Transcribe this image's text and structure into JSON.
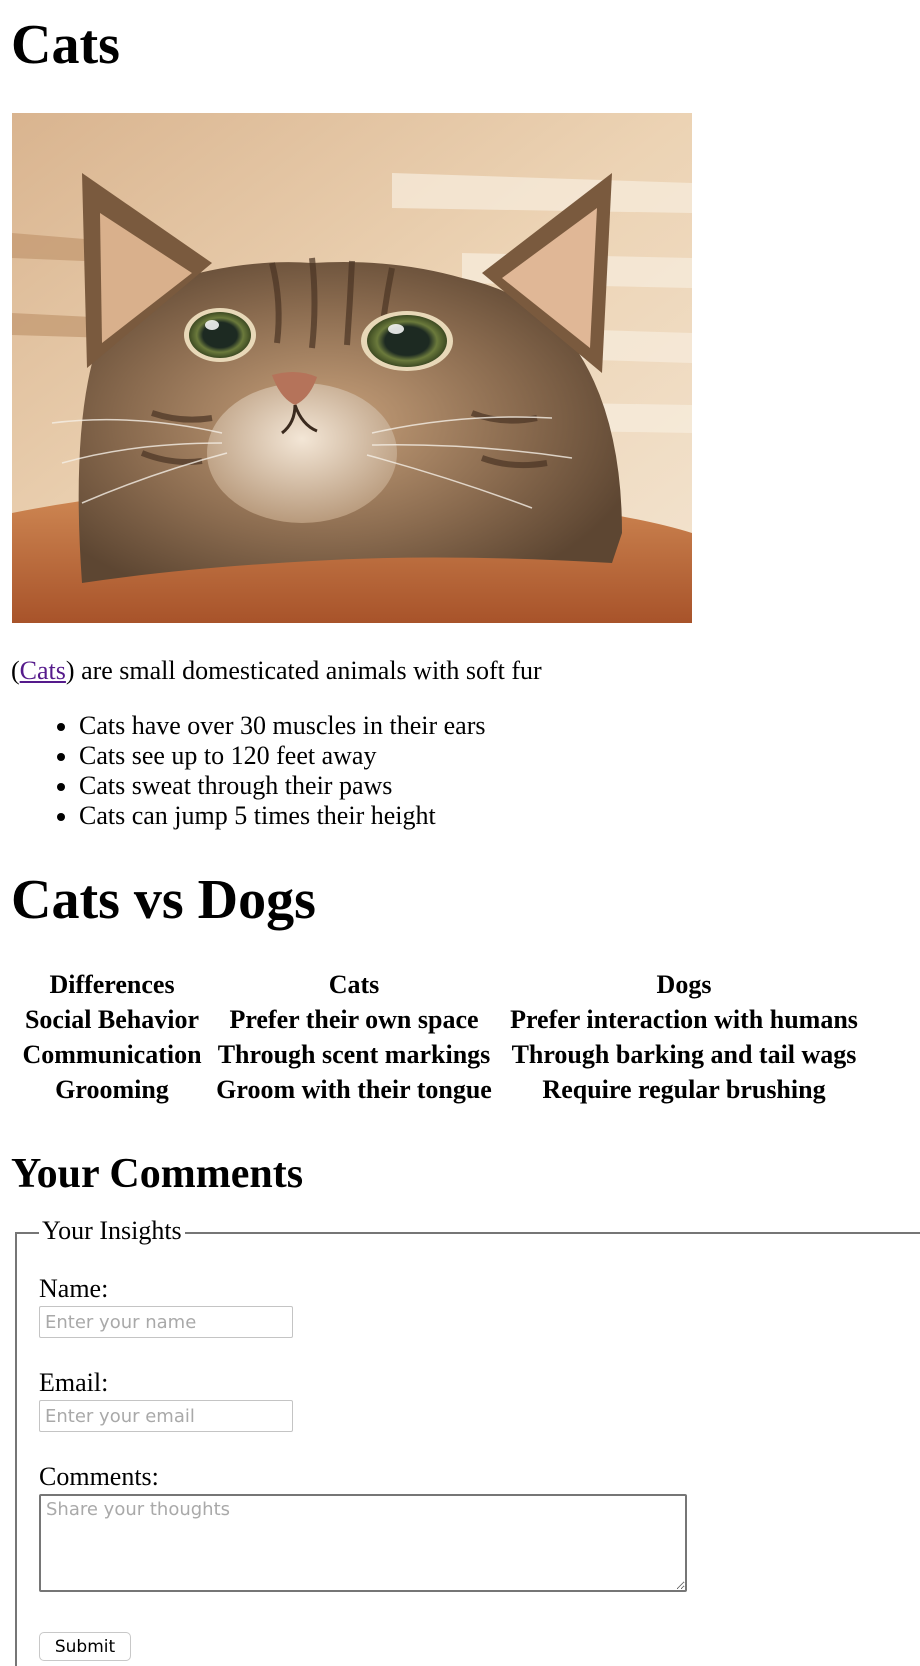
{
  "page": {
    "title": "Cats"
  },
  "hero_image": {
    "name": "cat-peeking-over-table-photo",
    "colors": {
      "background": "#e6c8a5",
      "blinds": "#f3e2cc",
      "table": "#c06a38",
      "fur": "#8a6b4f"
    }
  },
  "intro": {
    "open_paren": "(",
    "link_text": "Cats",
    "rest": ") are small domesticated animals with soft fur"
  },
  "facts": [
    "Cats have over 30 muscles in their ears",
    "Cats see up to 120 feet away",
    "Cats sweat through their paws",
    "Cats can jump 5 times their height"
  ],
  "comparison": {
    "title": "Cats vs Dogs",
    "headers": [
      "Differences",
      "Cats",
      "Dogs"
    ],
    "rows": [
      [
        "Social Behavior",
        "Prefer their own space",
        "Prefer interaction with humans"
      ],
      [
        "Communication",
        "Through scent markings",
        "Through barking and tail wags"
      ],
      [
        "Grooming",
        "Groom with their tongue",
        "Require regular brushing"
      ]
    ]
  },
  "comments": {
    "title": "Your Comments",
    "legend": "Your Insights",
    "name_label": "Name:",
    "name_placeholder": "Enter your name",
    "email_label": "Email:",
    "email_placeholder": "Enter your email",
    "comments_label": "Comments:",
    "comments_placeholder": "Share your thoughts",
    "submit_label": "Submit"
  }
}
